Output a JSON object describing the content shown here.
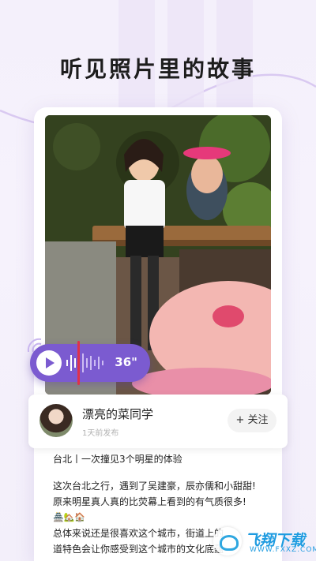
{
  "headline": "听见照片里的故事",
  "voice": {
    "duration": "36\""
  },
  "profile": {
    "username": "漂亮的菜同学",
    "time": "1天前发布",
    "follow_label": "+ 关注"
  },
  "post": {
    "title": "台北丨一次撞见3个明星的体验",
    "lines": [
      "这次台北之行，遇到了吴建豪，辰亦儒和小甜甜!",
      "原来明星真人真的比荧幕上看到的有气质很多!",
      "🏯🏡🏠",
      "总体来说还是很喜欢这个城市，街道上的",
      "道特色会让你感受到这个城市的文化底蕴"
    ]
  },
  "watermark": {
    "brand": "飞翔下载",
    "url": "WWW.FXXZ.COM"
  },
  "colors": {
    "accent": "#7b5bd0",
    "background": "#f4f0fb"
  }
}
